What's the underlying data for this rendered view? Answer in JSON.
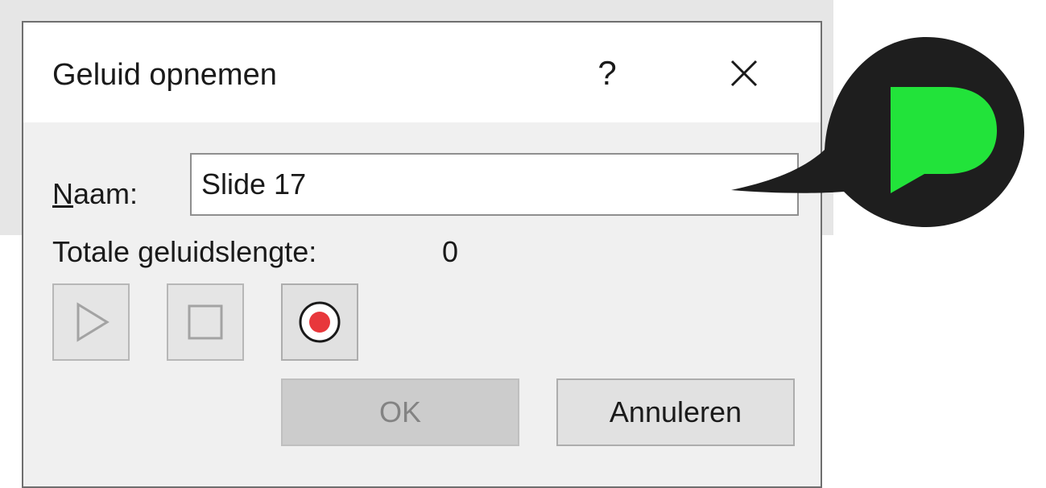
{
  "dialog": {
    "title": "Geluid opnemen",
    "help_label": "?",
    "name_label_accel": "N",
    "name_label_rest": "aam:",
    "name_value": "Slide 17",
    "length_label": "Totale geluidslengte:",
    "length_value": "0",
    "ok_label": "OK",
    "cancel_label": "Annuleren"
  },
  "icons": {
    "help": "question-mark",
    "close": "close-x-icon",
    "play": "play-triangle-icon",
    "stop": "stop-square-icon",
    "record": "record-dot-icon"
  },
  "colors": {
    "record_dot": "#e8373b",
    "logo_bubble": "#1e1e1e",
    "logo_mark": "#22e33a"
  }
}
